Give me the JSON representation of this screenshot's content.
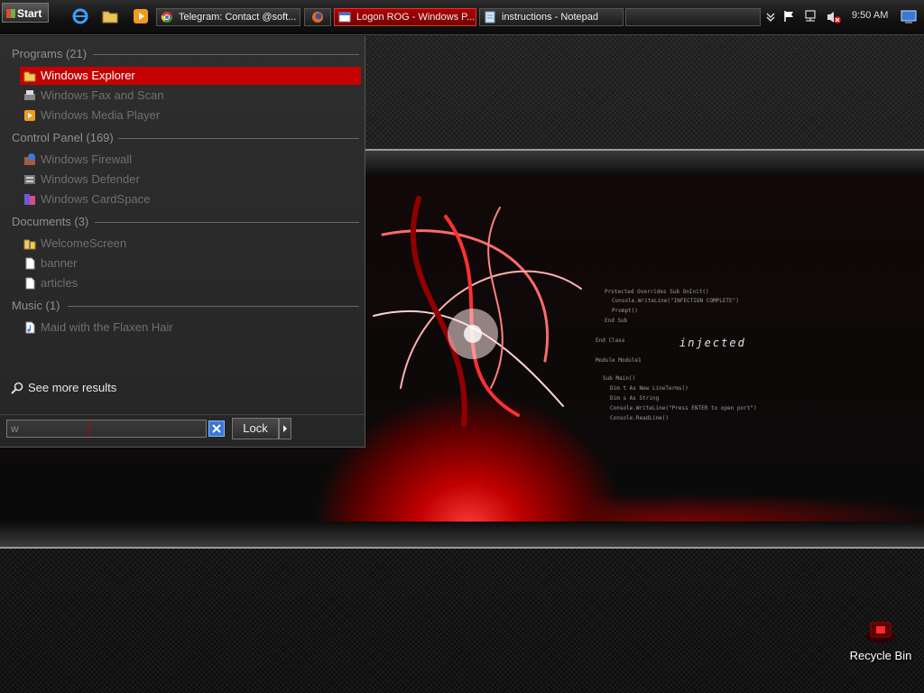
{
  "taskbar": {
    "start_label": "Start",
    "quick_launch": [
      {
        "icon": "internet-explorer-icon"
      },
      {
        "icon": "folder-icon"
      },
      {
        "icon": "media-player-icon"
      }
    ],
    "windows": [
      {
        "label": "Telegram: Contact @soft...",
        "icon": "chrome-icon",
        "active": false
      },
      {
        "label": "",
        "icon": "firefox-icon",
        "active": false
      },
      {
        "label": "Logon ROG - Windows P...",
        "icon": "window-icon",
        "active": true
      },
      {
        "label": "instructions - Notepad",
        "icon": "notepad-icon",
        "active": false
      }
    ],
    "tray": {
      "icons": [
        "chevron-down-icon",
        "flag-icon",
        "network-icon",
        "volume-muted-icon"
      ],
      "clock": "9:50 AM",
      "show_desktop_icon": "show-desktop-icon"
    }
  },
  "start_menu": {
    "groups": [
      {
        "header": "Programs (21)",
        "items": [
          {
            "label": "Windows Explorer",
            "icon": "explorer-icon",
            "selected": true
          },
          {
            "label": "Windows Fax and Scan",
            "icon": "fax-icon",
            "selected": false
          },
          {
            "label": "Windows Media Player",
            "icon": "media-player-icon",
            "selected": false
          }
        ]
      },
      {
        "header": "Control Panel (169)",
        "items": [
          {
            "label": "Windows Firewall",
            "icon": "firewall-icon",
            "selected": false
          },
          {
            "label": "Windows Defender",
            "icon": "defender-icon",
            "selected": false
          },
          {
            "label": "Windows CardSpace",
            "icon": "cardspace-icon",
            "selected": false
          }
        ]
      },
      {
        "header": "Documents (3)",
        "items": [
          {
            "label": "WelcomeScreen",
            "icon": "folder-zip-icon",
            "selected": false
          },
          {
            "label": "banner",
            "icon": "document-icon",
            "selected": false
          },
          {
            "label": "articles",
            "icon": "document-icon",
            "selected": false
          }
        ]
      },
      {
        "header": "Music (1)",
        "items": [
          {
            "label": "Maid with the Flaxen Hair",
            "icon": "music-file-icon",
            "selected": false
          }
        ]
      }
    ],
    "see_more": "See more results",
    "search": {
      "value": "w"
    },
    "lock_label": "Lock"
  },
  "desktop": {
    "wallpaper_text": "injected",
    "wallpaper_code": [
      "Protected Overrides Sub OnInit()",
      "Console.WriteLine(\"INFECTION COMPLETE\")",
      "Prompt()",
      "End Sub",
      "End Class",
      "Module Module1",
      "Sub Main()",
      "Dim t As New LineTerms()",
      "Dim s As String",
      "Console.WriteLine(\"Press ENTER to open port\")",
      "Console.ReadLine()"
    ],
    "icons": [
      {
        "label": "Recycle Bin",
        "icon": "recycle-bin-icon"
      }
    ]
  },
  "colors": {
    "accent": "#c40000",
    "menu_bg": "#2a2a2a",
    "muted_text": "#6f6f6f"
  }
}
